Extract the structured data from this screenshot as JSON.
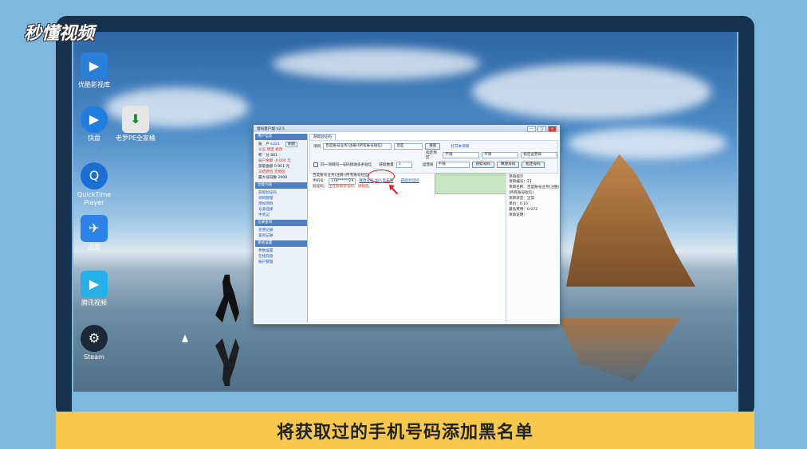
{
  "watermark": {
    "logo_text": "秒懂视频"
  },
  "caption": "将获取过的手机号码添加黑名单",
  "desktop_icons": [
    {
      "label": "优酷影视库",
      "icon": "youku-icon",
      "color": "#2a7fd8",
      "glyph": "▶"
    },
    {
      "label": "快盘",
      "icon": "player-icon",
      "color": "#1f7ee0",
      "glyph": "▶"
    },
    {
      "label": "老罗PE全家桶",
      "icon": "installer-icon",
      "color": "#e6e6e6",
      "glyph": "⬇"
    },
    {
      "label": "QuickTime Player",
      "icon": "quicktime-icon",
      "color": "#1b6fd1",
      "glyph": "Q"
    },
    {
      "label": "迅雷",
      "icon": "thunder-icon",
      "color": "#2d82e8",
      "glyph": "✈"
    },
    {
      "label": "腾讯视频",
      "icon": "tencent-video-icon",
      "color": "#26b0e8",
      "glyph": "▶"
    },
    {
      "label": "Steam",
      "icon": "steam-icon",
      "color": "#1b2838",
      "glyph": "⚙"
    }
  ],
  "app_window": {
    "title": "猎码客户端 V2.5",
    "window_controls": [
      "—",
      "□",
      "×"
    ],
    "account_panel": {
      "header": "用户信息",
      "rows": [
        {
          "label": "账　户",
          "value": "k321",
          "style": "normal"
        },
        {
          "label": "",
          "value": "认证  绑定  修改",
          "style": "red"
        },
        {
          "label": "积　分",
          "value": "861",
          "style": "normal"
        },
        {
          "label": "账户余额",
          "value": "-0.004 元",
          "style": "red"
        },
        {
          "label": "获取金额",
          "value": "0.901 元",
          "style": "normal"
        },
        {
          "label": "冻结原因",
          "value": "无原因",
          "style": "red"
        },
        {
          "label": "最大号码数",
          "value": "2000",
          "style": "normal"
        }
      ],
      "refresh_button": "刷新"
    },
    "menu_sections": [
      {
        "header": "功能列表",
        "items": [
          "获取验证码",
          "项目管理",
          "添加项目",
          "号源选择",
          "中奖记"
        ]
      },
      {
        "header": "记录查询",
        "items": [
          "充值记录",
          "查询记录"
        ]
      },
      {
        "header": "系统设置",
        "items": [
          "参数设置",
          "在线充值",
          "账户管理"
        ]
      }
    ],
    "tab_label": "获取验证码",
    "toolbar": {
      "project_label": "项目",
      "project_value": "百度账号业务(注册)(所有账号短信)",
      "query_value": "百度",
      "search_button": "搜索",
      "open_project_link": "打开本项目",
      "province_label": "指定地区",
      "province_value": "不限",
      "city_value": "不限",
      "operator_dropdown": "指定运营商",
      "checkbox_label": "同一项目同一号码接收多条短信",
      "count_label": "获取数量",
      "count_value": "1",
      "operator_label": "运营商",
      "operator_value": "不限",
      "get_number_button": "获取号码",
      "release_button": "释放号码",
      "add_number_button": "指定号码"
    },
    "result": {
      "title": "百度账号业务(注册)(所有账号短信)",
      "phone_label": "手机号：",
      "phone_value": "178******29",
      "release_link": "释放号码",
      "blacklist_link": "加入黑名单",
      "get_code_link": "获取验证码",
      "code_label": "验证码：",
      "code_value": "正在获取验证码，请稍后。"
    },
    "info_panel": {
      "header": "项目提示",
      "lines": [
        "项目编号：21",
        "项目名称：百度账号业务(注册)",
        "(所有账号短信)",
        "项目状态：正常",
        "单价：0.10",
        "最低费用：0.072",
        "项目说明："
      ]
    }
  },
  "colors": {
    "panel_header": "#4f7fc1",
    "caption_bg": "#f6c94d",
    "highlight": "#dd2222"
  }
}
